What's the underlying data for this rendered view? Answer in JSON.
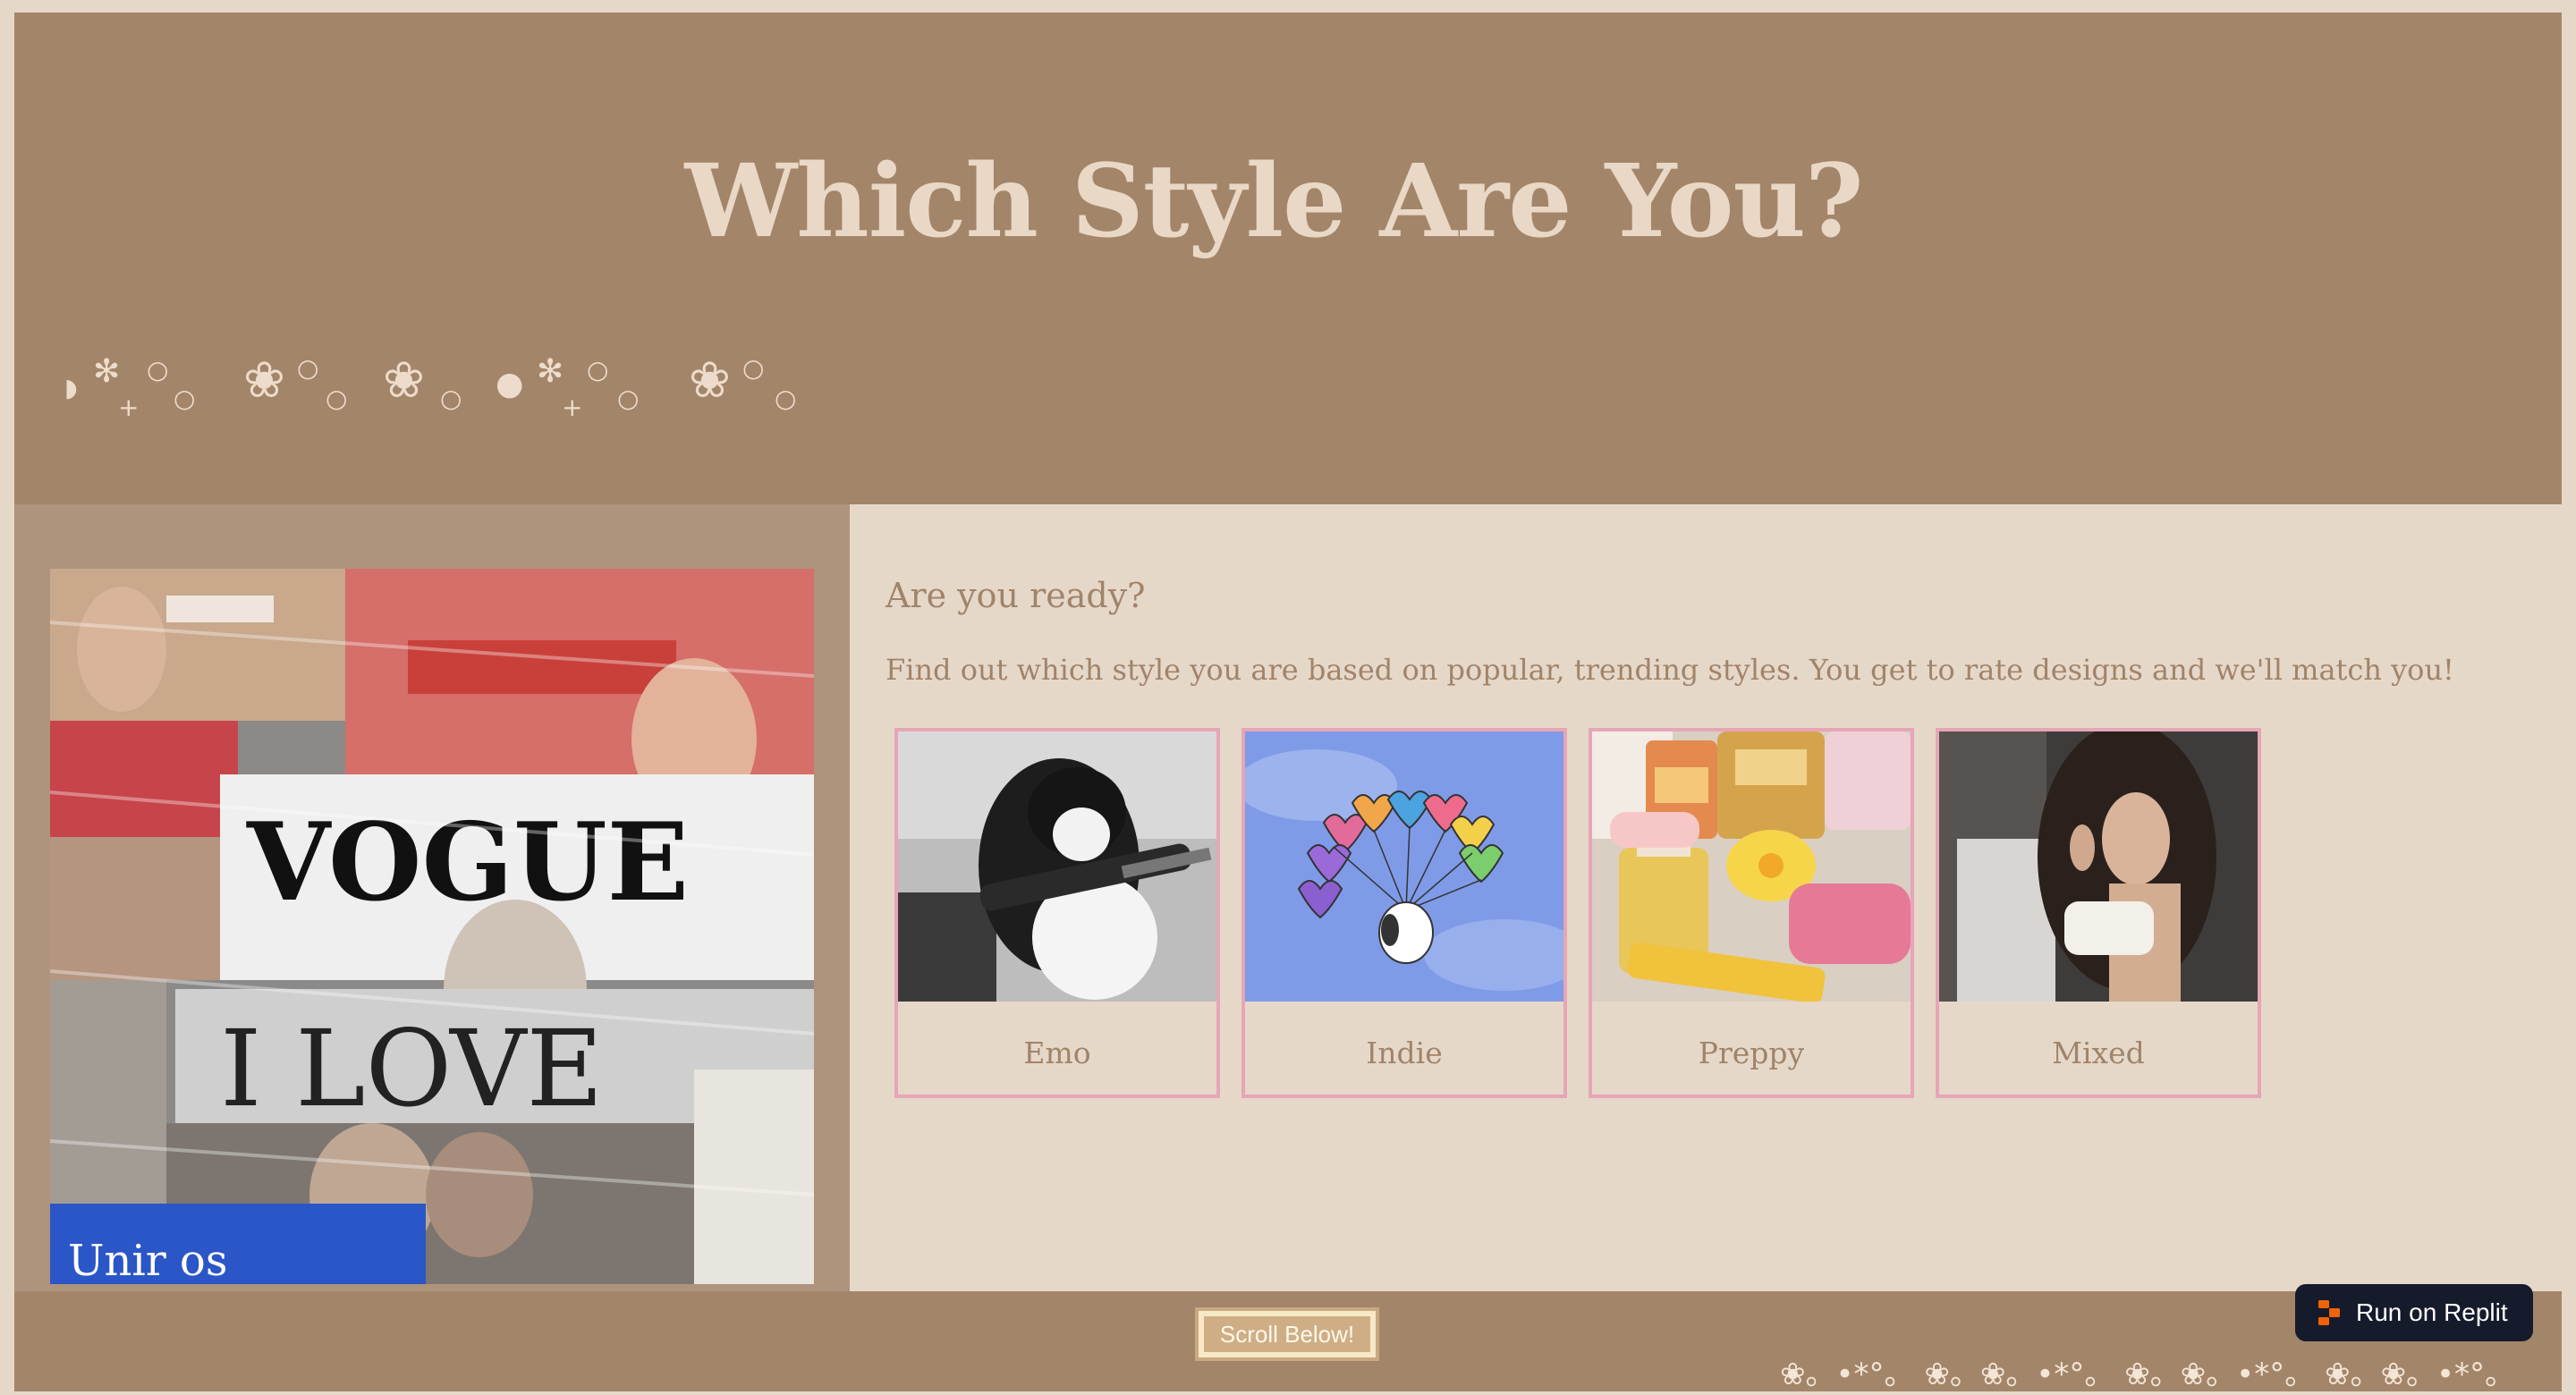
{
  "header": {
    "title": "Which Style Are You?",
    "decoration": [
      {
        "glyph": "*",
        "kind": "asterisk"
      },
      {
        "glyph": "°",
        "kind": "circle"
      },
      {
        "glyph": "+",
        "kind": "plus"
      },
      {
        "glyph": "❀",
        "kind": "flower"
      },
      {
        "glyph": "•",
        "kind": "dot"
      }
    ]
  },
  "main": {
    "heading": "Are you ready?",
    "description": "Find out which style you are based on popular, trending styles. You get to rate designs and we'll match you!",
    "cards": [
      {
        "label": "Emo",
        "image": "cat-playing-guitar-photo"
      },
      {
        "label": "Indie",
        "image": "snoopy-heart-balloons-photo"
      },
      {
        "label": "Preppy",
        "image": "beauty-products-photo"
      },
      {
        "label": "Mixed",
        "image": "woman-applying-makeup-photo"
      }
    ],
    "side_image": "magazine-rack-photo"
  },
  "footer": {
    "scroll_label": "Scroll Below!",
    "replit_label": "Run on Replit",
    "replit_icon": "replit-icon"
  },
  "colors": {
    "page_bg": "#e6d8c9",
    "header_bg": "#a3856a",
    "side_panel_bg": "#ae947d",
    "text": "#a0846a",
    "title": "#e9d8c6",
    "card_border": "#e6a6b6",
    "replit_bg": "#161b2b",
    "replit_accent": "#f26207"
  }
}
